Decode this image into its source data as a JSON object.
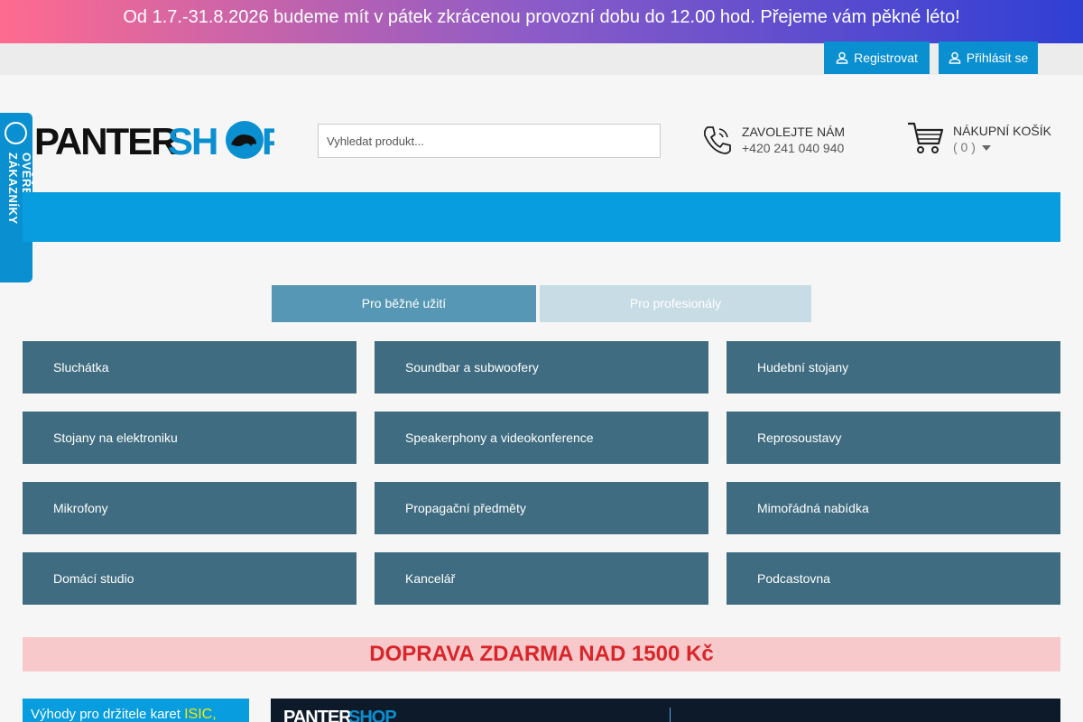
{
  "announcement": "Od 1.7.-31.8.2026 budeme mít v pátek zkrácenou provozní dobu do 12.00 hod. Přejeme vám pěkné léto!",
  "account": {
    "register_label": "Registrovat",
    "login_label": "Přihlásit se"
  },
  "search": {
    "placeholder": "Vyhledat produkt..."
  },
  "contact": {
    "title": "ZAVOLEJTE NÁM",
    "phone": "+420 241 040 940"
  },
  "cart": {
    "title": "NÁKUPNÍ KOŠÍK",
    "count": "( 0 )"
  },
  "badge": {
    "text": "OVĚŘENO ZÁKAZNÍKY"
  },
  "tabs": [
    {
      "label": "Pro běžné užití",
      "active": true
    },
    {
      "label": "Pro profesionály",
      "active": false
    }
  ],
  "categories": [
    {
      "label": "Sluchátka"
    },
    {
      "label": "Soundbar a subwoofery"
    },
    {
      "label": "Hudební stojany"
    },
    {
      "label": "Stojany na elektroniku"
    },
    {
      "label": "Speakerphony a videokonference"
    },
    {
      "label": "Reprosoustavy"
    },
    {
      "label": "Mikrofony"
    },
    {
      "label": "Propagační předměty"
    },
    {
      "label": "Mimořádná nabídka"
    },
    {
      "label": "Domácí studio"
    },
    {
      "label": "Kancelář"
    },
    {
      "label": "Podcastovna"
    }
  ],
  "promo": "DOPRAVA ZDARMA NAD 1500 Kč",
  "isic": {
    "text": "Výhody pro držitele karet ",
    "highlight": "ISIC,"
  },
  "colors": {
    "accent": "#0a8fd0",
    "category_bg": "#3f6c80",
    "promo_text": "#d9252a",
    "promo_bg": "#f8c9ca"
  }
}
